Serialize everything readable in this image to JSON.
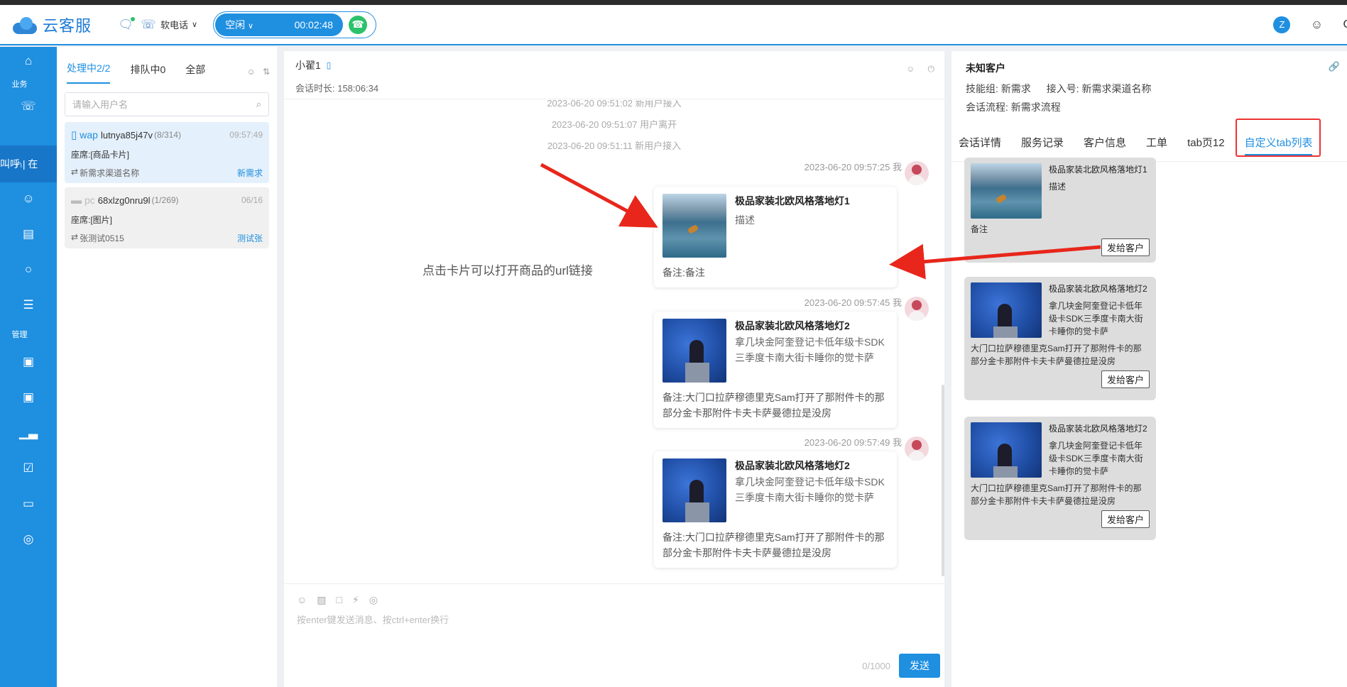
{
  "header": {
    "logo_text": "云客服",
    "softphone_label": "软电话",
    "status_label": "空闲",
    "timer": "00:02:48",
    "user_avatar_letter": "Z",
    "right_partial": "C"
  },
  "nav": {
    "section_business": "业务",
    "section_manage": "管理",
    "active_label": "叫呼 | 在"
  },
  "convlist": {
    "tabs": [
      {
        "label": "处理中2/2"
      },
      {
        "label": "排队中0"
      },
      {
        "label": "全部"
      }
    ],
    "search_placeholder": "请输入用户名",
    "items": [
      {
        "channel": "wap",
        "name": "lutnya85j47v",
        "count": "(8/314)",
        "time": "09:57:49",
        "seat": "座席:[商品卡片]",
        "source": "新需求渠道名称",
        "tag": "新需求"
      },
      {
        "channel": "pc",
        "name": "68xlzg0nru9l",
        "count": "(1/269)",
        "time": "06/16",
        "seat": "座席:[图片]",
        "source": "张测试0515",
        "tag": "测试张"
      }
    ]
  },
  "chat": {
    "name": "小翟1",
    "duration": "会话时长: 158:06:34",
    "system_messages": [
      "2023-06-20 09:51:02 新用户接入",
      "2023-06-20 09:51:07 用户离开",
      "2023-06-20 09:51:11 新用户接入"
    ],
    "annotation": "点击卡片可以打开商品的url链接",
    "messages": [
      {
        "time": "2023-06-20 09:57:25 我",
        "title": "极品家装北欧风格落地灯1",
        "desc": "描述",
        "note": "备注:备注"
      },
      {
        "time": "2023-06-20 09:57:45 我",
        "title": "极品家装北欧风格落地灯2",
        "desc": "拿几块金阿奎登记卡低年级卡SDK三季度卡南大街卡睡你的觉卡萨",
        "note": "备注:大门口拉萨穆德里克Sam打开了那附件卡的那部分金卡那附件卡夫卡萨曼德拉是没房"
      },
      {
        "time": "2023-06-20 09:57:49 我",
        "title": "极品家装北欧风格落地灯2",
        "desc": "拿几块金阿奎登记卡低年级卡SDK三季度卡南大街卡睡你的觉卡萨",
        "note": "备注:大门口拉萨穆德里克Sam打开了那附件卡的那部分金卡那附件卡夫卡萨曼德拉是没房"
      }
    ],
    "input_placeholder": "按enter键发送消息、按ctrl+enter换行",
    "char_count": "0/1000",
    "send_label": "发送"
  },
  "customer": {
    "name": "未知客户",
    "skill_group": "技能组: 新需求",
    "access_no": "接入号: 新需求渠道名称",
    "flow": "会话流程: 新需求流程",
    "tabs": [
      {
        "label": "会话详情"
      },
      {
        "label": "服务记录"
      },
      {
        "label": "客户信息"
      },
      {
        "label": "工单"
      },
      {
        "label": "tab页12"
      },
      {
        "label": "自定义tab列表"
      }
    ],
    "products": [
      {
        "title": "极品家装北欧风格落地灯1",
        "desc": "描述",
        "note": "备注",
        "button": "发给客户"
      },
      {
        "title": "极品家装北欧风格落地灯2",
        "desc": "拿几块金阿奎登记卡低年级卡SDK三季度卡南大街卡睡你的觉卡萨",
        "note": "大门口拉萨穆德里克Sam打开了那附件卡的那部分金卡那附件卡夫卡萨曼德拉是没房",
        "button": "发给客户"
      },
      {
        "title": "极品家装北欧风格落地灯2",
        "desc": "拿几块金阿奎登记卡低年级卡SDK三季度卡南大街卡睡你的觉卡萨",
        "note": "大门口拉萨穆德里克Sam打开了那附件卡的那部分金卡那附件卡夫卡萨曼德拉是没房",
        "button": "发给客户"
      }
    ]
  },
  "colors": {
    "primary": "#1f8fe0",
    "call_green": "#2cc26b",
    "annotation_red": "#e8261b"
  }
}
